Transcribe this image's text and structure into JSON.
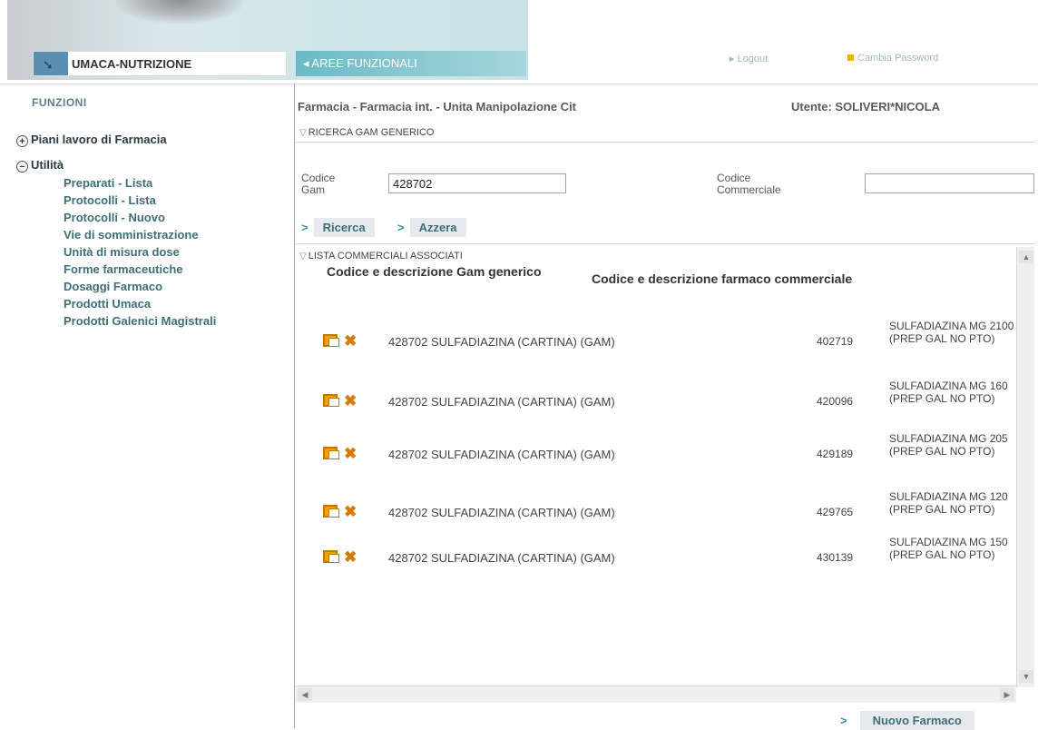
{
  "header": {
    "module_tab": "UMACA-NUTRIZIONE",
    "aree_tab": "AREE FUNZIONALI",
    "logout": "Logout",
    "cambia_password": "Cambia Password"
  },
  "sidebar": {
    "title": "FUNZIONI",
    "groups": [
      {
        "label": "Piani lavoro di Farmacia",
        "symbol": "+"
      },
      {
        "label": "Utilità",
        "symbol": "−"
      }
    ],
    "items": [
      "Preparati - Lista",
      "Protocolli - Lista",
      "Protocolli - Nuovo",
      "Vie di somministrazione",
      "Unità di misura dose",
      "Forme farmaceutiche",
      "Dosaggi Farmaco",
      "Prodotti Umaca",
      "Prodotti Galenici Magistrali"
    ]
  },
  "main": {
    "context": "Farmacia - Farmacia int. - Unita Manipolazione Cit",
    "user": "Utente: SOLIVERI*NICOLA",
    "search_section": "RICERCA GAM GENERICO",
    "codice_gam_label": "Codice Gam",
    "codice_gam_value": "428702",
    "codice_comm_label": "Codice Commerciale",
    "codice_comm_value": "",
    "ricerca": "Ricerca",
    "azzera": "Azzera",
    "list_section": "LISTA COMMERCIALI ASSOCIATI",
    "col_gam": "Codice e descrizione Gam generico",
    "col_comm": "Codice e descrizione farmaco commerciale",
    "rows": [
      {
        "gam": "428702 SULFADIAZINA (CARTINA) (GAM)",
        "code": "402719",
        "desc": "SULFADIAZINA MG 2100 (PREP GAL NO PTO)"
      },
      {
        "gam": "428702 SULFADIAZINA (CARTINA) (GAM)",
        "code": "420096",
        "desc": "SULFADIAZINA MG 160 (PREP GAL NO PTO)"
      },
      {
        "gam": "428702 SULFADIAZINA (CARTINA) (GAM)",
        "code": "429189",
        "desc": "SULFADIAZINA MG 205 (PREP GAL NO PTO)"
      },
      {
        "gam": "428702 SULFADIAZINA (CARTINA) (GAM)",
        "code": "429765",
        "desc": "SULFADIAZINA MG 120 (PREP GAL NO PTO)"
      },
      {
        "gam": "428702 SULFADIAZINA (CARTINA) (GAM)",
        "code": "430139",
        "desc": "SULFADIAZINA MG 150 (PREP GAL NO PTO)"
      }
    ],
    "nuovo_farmaco": "Nuovo Farmaco"
  }
}
